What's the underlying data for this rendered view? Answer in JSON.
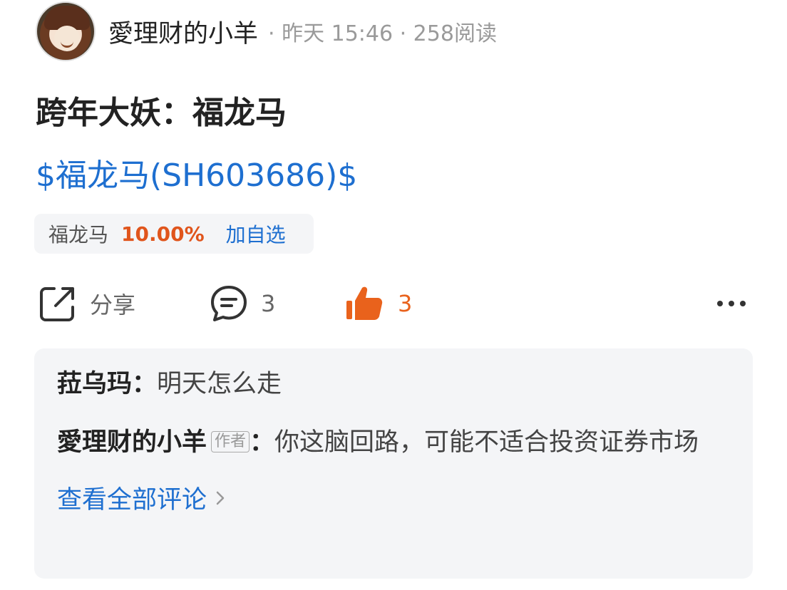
{
  "post": {
    "author": "愛理财的小羊",
    "meta": "· 昨天 15:46 · 258阅读",
    "title": "跨年大妖：福龙马",
    "stock_link": "$福龙马(SH603686)$"
  },
  "stock_chip": {
    "name": "福龙马",
    "change": "10.00%",
    "add_watch": "加自选",
    "change_color": "#e0551c"
  },
  "actions": {
    "share_label": "分享",
    "comment_count": "3",
    "like_count": "3",
    "like_color": "#e9621c"
  },
  "comments": {
    "items": [
      {
        "author": "菈乌玛",
        "sep": "：",
        "text": "明天怎么走"
      },
      {
        "author": "愛理财的小羊",
        "badge": "作者",
        "sep": "：",
        "text": "你这脑回路，可能不适合投资证券市场"
      }
    ],
    "view_all": "查看全部评论"
  }
}
